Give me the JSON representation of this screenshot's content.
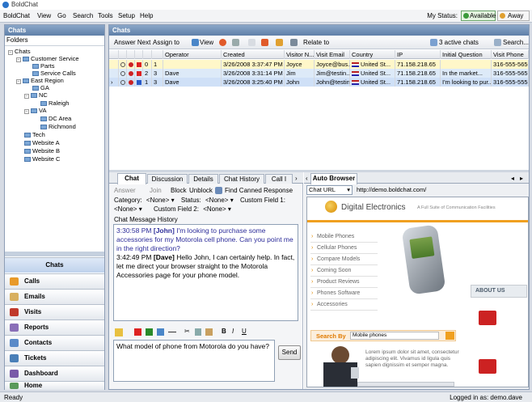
{
  "window": {
    "title": "BoldChat"
  },
  "menu": {
    "items": [
      "BoldChat",
      "View",
      "Go",
      "Search",
      "Tools",
      "Setup",
      "Help"
    ]
  },
  "status": {
    "label": "My Status:",
    "available": "Available",
    "away": "Away"
  },
  "left": {
    "header": "Chats",
    "folders_label": "Folders",
    "tree": [
      "Chats",
      "Customer Service",
      "Parts",
      "Service Calls",
      "East Region",
      "GA",
      "NC",
      "Raleigh",
      "VA",
      "DC Area",
      "Richmond",
      "Tech",
      "Website A",
      "Website B",
      "Website C"
    ],
    "nav": [
      "Chats",
      "Calls",
      "Emails",
      "Visits",
      "Reports",
      "Contacts",
      "Tickets",
      "Dashboard",
      "Home"
    ]
  },
  "main": {
    "header": "Chats",
    "toolbar": {
      "answer_next": "Answer Next",
      "assign_to": "Assign to",
      "view": "View",
      "relate_to": "Relate to",
      "active_chats": "3 active chats",
      "search": "Search..."
    },
    "columns": [
      "Operator",
      "Created",
      "Visitor N...",
      "Visit Email",
      "Country",
      "IP",
      "Initial Question",
      "Visit Phone"
    ],
    "rows": [
      {
        "n1": "0",
        "n2": "1",
        "operator": "",
        "created": "3/26/2008 3:37:47 PM",
        "visitor": "Joyce",
        "email": "Joyce@bus...",
        "country": "United St...",
        "ip": "71.158.218.65",
        "question": "",
        "phone": "316-555-5656"
      },
      {
        "n1": "2",
        "n2": "3",
        "operator": "Dave",
        "created": "3/26/2008 3:31:14 PM",
        "visitor": "Jim",
        "email": "Jim@testin...",
        "country": "United St...",
        "ip": "71.158.218.65",
        "question": "In the market...",
        "phone": "316-555-5657"
      },
      {
        "n1": "1",
        "n2": "3",
        "operator": "Dave",
        "created": "3/26/2008 3:25:40 PM",
        "visitor": "John",
        "email": "John@testin...",
        "country": "United St...",
        "ip": "71.158.218.65",
        "question": "I'm looking to pur...",
        "phone": "316-555-5555"
      }
    ],
    "chat_tabs": [
      "Chat",
      "Discussion",
      "Details",
      "Chat History",
      "Call I"
    ],
    "chat_toolbar": {
      "answer": "Answer",
      "join": "Join",
      "block": "Block",
      "unblock": "Unblock",
      "canned": "Find Canned Response"
    },
    "fields": {
      "category_label": "Category:",
      "category_value": "<None>",
      "status_label": "Status:",
      "status_value": "<None>",
      "cf1_label": "Custom Field 1:",
      "cf1_value": "<None>",
      "cf2_label": "Custom Field 2:",
      "cf2_value": "<None>"
    },
    "history_label": "Chat Message History",
    "messages": [
      {
        "time": "3:30:58 PM",
        "who": "[John]",
        "text": "I'm looking to purchase some accessories for my Motorola cell phone. Can you point me in the right direction?"
      },
      {
        "time": "3:42:49 PM",
        "who": "[Dave]",
        "text": "Hello John, I can certainly help. In fact, let me direct your browser straight to the Motorola Accessories page for your phone model."
      }
    ],
    "compose_text": "What model of phone from Motorola do you have?",
    "send_label": "Send",
    "browser_tab": "Auto Browser",
    "url_select": "Chat URL",
    "url": "http://demo.boldchat.com/",
    "site": {
      "brand": "Digital Electronics",
      "tagline": "A Full Suite of Communication Facilities",
      "menu": [
        "Mobile Phones",
        "Cellular Phones",
        "Compare Models",
        "Coming Soon",
        "Product Reviews",
        "Phones Software",
        "Accessories"
      ],
      "about": "ABOUT US",
      "search_by": "Search By",
      "search_value": "Mobile phones",
      "lorem": "Lorem ipsum dolor sit amet, consectetur adipiscing elit. Vivamus id ligula quis sapien dignissim et semper magna."
    }
  },
  "statusbar": {
    "left": "Ready",
    "right": "Logged in as: demo.dave"
  }
}
